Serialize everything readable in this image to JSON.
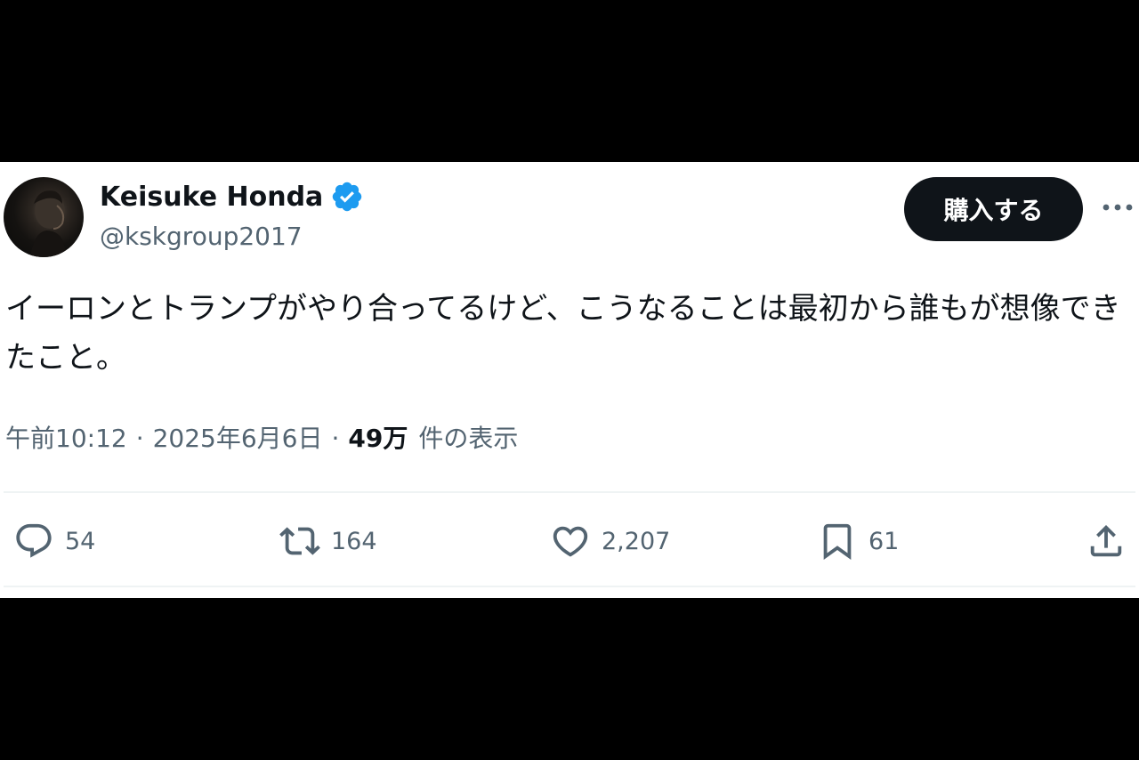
{
  "theme": {
    "background": "#000000",
    "card_background": "#ffffff",
    "text_primary": "#0f1419",
    "text_secondary": "#536471",
    "verified_blue": "#1d9bf0",
    "button_background": "#0f1419",
    "divider": "#eff3f4"
  },
  "author": {
    "display_name": "Keisuke Honda",
    "handle": "@kskgroup2017",
    "verified_icon": "verified-badge-icon",
    "avatar": "profile-photo"
  },
  "header": {
    "buy_button_label": "購入する",
    "more_icon": "more-horizontal-icon"
  },
  "tweet": {
    "text": "イーロンとトランプがやり合ってるけど、こうなることは最初から誰もが想像できたこと。"
  },
  "meta": {
    "time": "午前10:12",
    "separator": "·",
    "date": "2025年6月6日",
    "views_count": "49万",
    "views_label": "件の表示"
  },
  "actions": {
    "reply": {
      "icon": "reply-icon",
      "count": "54"
    },
    "retweet": {
      "icon": "retweet-icon",
      "count": "164"
    },
    "like": {
      "icon": "heart-icon",
      "count": "2,207"
    },
    "bookmark": {
      "icon": "bookmark-icon",
      "count": "61"
    },
    "share": {
      "icon": "share-icon"
    }
  }
}
